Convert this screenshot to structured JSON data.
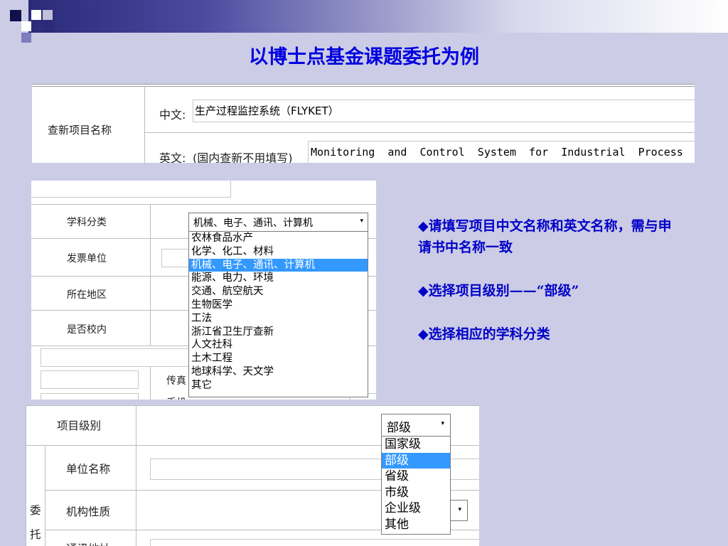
{
  "slide": {
    "title": "以博士点基金课题委托为例",
    "bullets": [
      "◆请填写项目中文名称和英文名称，需与申请书中名称一致",
      "◆选择项目级别——“部级”",
      "◆选择相应的学科分类"
    ]
  },
  "project_name_form": {
    "row_label": "查新项目名称",
    "chinese_label": "中文:",
    "chinese_value": "生产过程监控系统（FLYKET）",
    "english_label": "英文:",
    "english_hint": "(国内查新不用填写)",
    "english_value": "Monitoring  and  Control  System  for  Industrial  Process"
  },
  "discipline_form": {
    "labels": {
      "discipline": "学科分类",
      "invoice_unit": "发票单位",
      "region": "所在地区",
      "on_campus": "是否校内",
      "fax": "传真",
      "mobile_partial": "手机"
    },
    "discipline_selected": "机械、电子、通讯、计算机",
    "discipline_options": [
      "农林食品水产",
      "化学、化工、材料",
      "机械、电子、通讯、计算机",
      "能源、电力、环境",
      "交通、航空航天",
      "生物医学",
      "工法",
      "浙江省卫生厅查新",
      "人文社科",
      "土木工程",
      "地球科学、天文学",
      "其它"
    ],
    "discipline_highlight_index": 2
  },
  "level_form": {
    "labels": {
      "level": "项目级别",
      "unit_name": "单位名称",
      "org_nature": "机构性质",
      "side_1": "委",
      "side_2": "托",
      "bottom_partial": "通讯地址"
    },
    "level_selected": "部级",
    "level_options": [
      "国家级",
      "部级",
      "省级",
      "市级",
      "企业级",
      "其他"
    ],
    "level_highlight_index": 1
  },
  "icons": {
    "dropdown_caret": "▾"
  },
  "colors": {
    "background": "#cccce6",
    "title": "#0000e0",
    "bullets": "#0000c8",
    "selection": "#3399ff"
  }
}
